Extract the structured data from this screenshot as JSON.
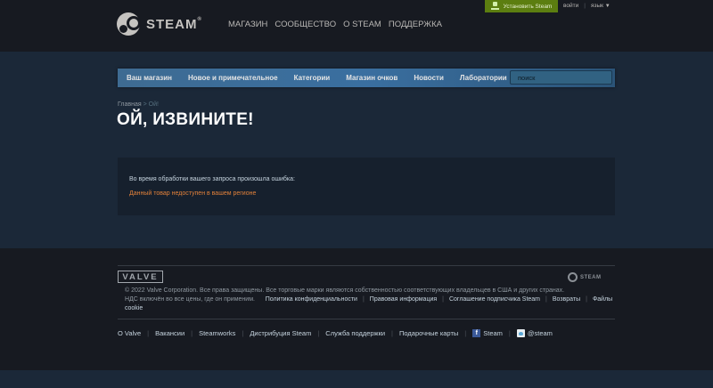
{
  "header": {
    "logo_text": "STEAM",
    "logo_tm": "®",
    "nav": [
      "МАГАЗИН",
      "СООБЩЕСТВО",
      "О STEAM",
      "ПОДДЕРЖКА"
    ],
    "install_label": "Установить Steam",
    "login_label": "войти",
    "language_label": "язык",
    "accent_color": "#5c7e10"
  },
  "storenav": {
    "items": [
      "Ваш магазин",
      "Новое и примечательное",
      "Категории",
      "Магазин очков",
      "Новости",
      "Лаборатории"
    ],
    "search_placeholder": "поиск"
  },
  "breadcrumb": {
    "home": "Главная",
    "separator": ">",
    "current": "Ой!"
  },
  "page_title": "ОЙ, ИЗВИНИТЕ!",
  "error": {
    "message": "Во время обработки вашего запроса произошла ошибка:",
    "detail": "Данный товар недоступен в вашем регионе",
    "detail_color": "#e1803a"
  },
  "footer": {
    "valve_logo": "VALVE",
    "steam_logo": "STEAM",
    "copyright": "© 2022 Valve Corporation. Все права защищены. Все торговые марки являются собственностью соответствующих владельцев в США и других странах.",
    "vat_note": "НДС включён во все цены, где он применим.",
    "legal_links": [
      "Политика конфиденциальности",
      "Правовая информация",
      "Соглашение подписчика Steam",
      "Возвраты",
      "Файлы cookie"
    ],
    "links": [
      "О Valve",
      "Вакансии",
      "Steamworks",
      "Дистрибуция Steam",
      "Служба поддержки",
      "Подарочные карты",
      "Steam",
      "@steam"
    ]
  }
}
